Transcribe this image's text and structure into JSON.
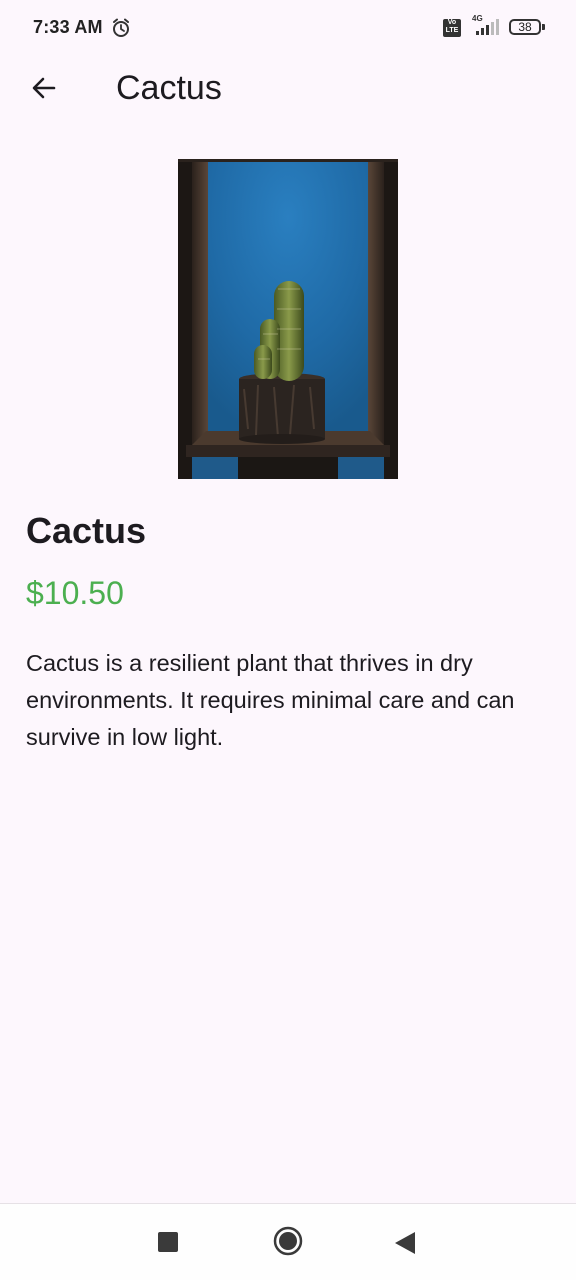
{
  "status_bar": {
    "time": "7:33 AM",
    "alarm_icon": "alarm-clock-icon",
    "volte_label_top": "Vo",
    "volte_label_bottom": "LTE",
    "network_type": "4G",
    "battery_level": "38"
  },
  "app_bar": {
    "back_icon": "arrow-back-icon",
    "title": "Cactus"
  },
  "product": {
    "name": "Cactus",
    "price": "$10.50",
    "description": "Cactus is a resilient plant that thrives in dry environments. It requires minimal care and can survive in low light.",
    "price_color": "#4caf50"
  },
  "navigation_bar": {
    "recents_icon": "square-recents-icon",
    "home_icon": "circle-home-icon",
    "back_icon": "triangle-back-icon"
  }
}
